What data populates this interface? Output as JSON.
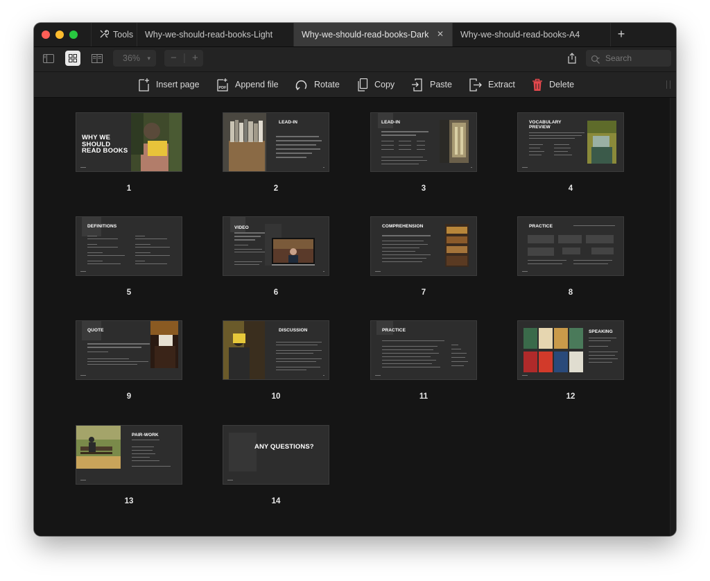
{
  "window": {
    "tabs": [
      {
        "label": "Tools"
      },
      {
        "label": "Why-we-should-read-books-Light"
      },
      {
        "label": "Why-we-should-read-books-Dark"
      },
      {
        "label": "Why-we-should-read-books-A4"
      }
    ],
    "new_tab": "+",
    "close": "✕"
  },
  "viewbar": {
    "zoom": "36%",
    "zoom_out": "−",
    "zoom_in": "+",
    "search_placeholder": "Search"
  },
  "actions": {
    "insert_page": "Insert page",
    "append_file": "Append file",
    "append_badge": "PDF",
    "rotate": "Rotate",
    "copy": "Copy",
    "paste": "Paste",
    "extract": "Extract",
    "delete": "Delete"
  },
  "pages": [
    {
      "number": "1",
      "title_lines": [
        "WHY WE",
        "SHOULD",
        "READ BOOKS"
      ]
    },
    {
      "number": "2",
      "title": "LEAD-IN"
    },
    {
      "number": "3",
      "title": "LEAD-IN"
    },
    {
      "number": "4",
      "title_lines": [
        "VOCABULARY",
        "PREVIEW"
      ]
    },
    {
      "number": "5",
      "title": "DEFINITIONS"
    },
    {
      "number": "6",
      "title": "VIDEO"
    },
    {
      "number": "7",
      "title": "COMPREHENSION"
    },
    {
      "number": "8",
      "title": "PRACTICE"
    },
    {
      "number": "9",
      "title": "QUOTE"
    },
    {
      "number": "10",
      "title": "DISCUSSION"
    },
    {
      "number": "11",
      "title": "PRACTICE"
    },
    {
      "number": "12",
      "title": "SPEAKING"
    },
    {
      "number": "13",
      "title": "PAIR-WORK"
    },
    {
      "number": "14",
      "title": "ANY QUESTIONS?"
    }
  ],
  "colors": {
    "traffic_red": "#fe5f57",
    "traffic_yellow": "#febc2e",
    "traffic_green": "#28c840",
    "delete_red": "#e5484d",
    "background": "#151515"
  }
}
